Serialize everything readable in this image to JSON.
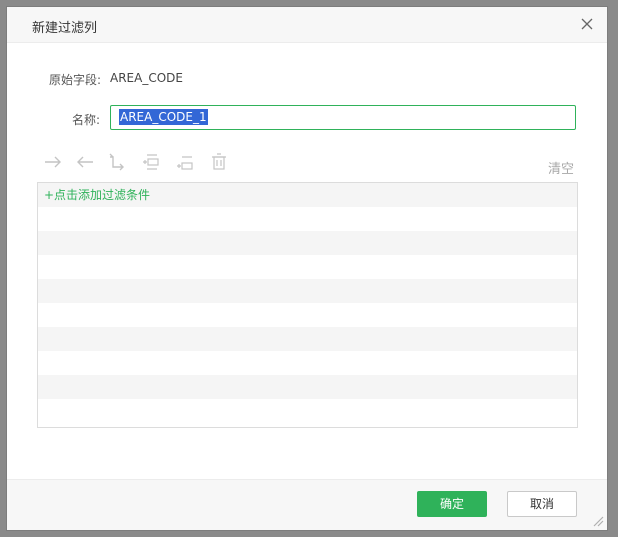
{
  "dialog": {
    "title": "新建过滤列",
    "close_icon": "close-icon"
  },
  "form": {
    "original_field_label": "原始字段:",
    "original_field_value": "AREA_CODE",
    "name_label": "名称:",
    "name_value": "AREA_CODE_1"
  },
  "toolbar": {
    "icons": [
      "arrow-right-icon",
      "arrow-left-icon",
      "indent-arrow-icon",
      "add-condition-before-icon",
      "add-condition-after-icon",
      "delete-icon"
    ],
    "clear_label": "清空"
  },
  "conditions": {
    "add_label": "+点击添加过滤条件"
  },
  "footer": {
    "ok_label": "确定",
    "cancel_label": "取消"
  },
  "colors": {
    "accent": "#2fb25a",
    "selection": "#3367d6"
  }
}
